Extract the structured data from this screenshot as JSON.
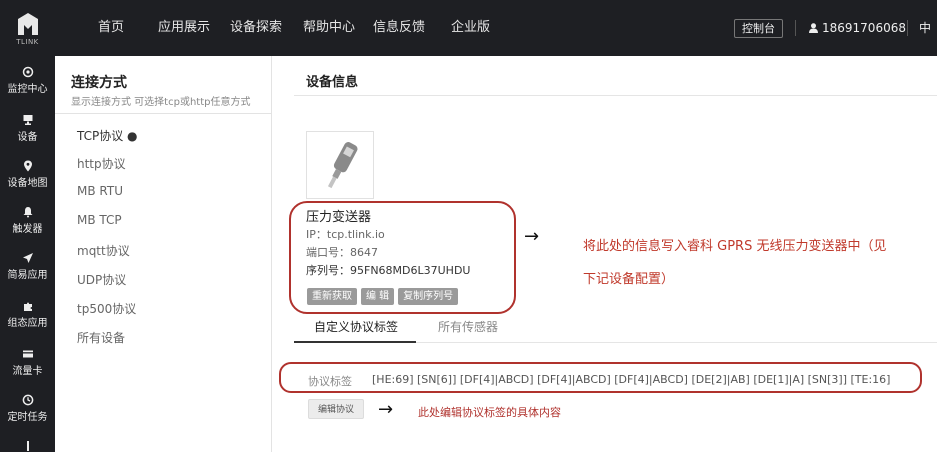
{
  "brand": {
    "logo_text": "TLINK",
    "logo_icon": "tlink-logo-icon"
  },
  "topnav": {
    "items": [
      "首页",
      "应用展示",
      "设备探索",
      "帮助中心",
      "信息反馈",
      "企业版"
    ],
    "console_button": "控制台",
    "user_phone": "18691706068",
    "user_icon": "user-icon",
    "lang_partial": "中"
  },
  "sidebar": {
    "items": [
      {
        "label": "监控中心",
        "icon": "target-icon"
      },
      {
        "label": "设备",
        "icon": "monitor-icon"
      },
      {
        "label": "设备地图",
        "icon": "map-pin-icon"
      },
      {
        "label": "触发器",
        "icon": "bell-icon"
      },
      {
        "label": "简易应用",
        "icon": "send-icon"
      },
      {
        "label": "组态应用",
        "icon": "puzzle-icon"
      },
      {
        "label": "流量卡",
        "icon": "card-icon"
      },
      {
        "label": "定时任务",
        "icon": "clock-icon"
      }
    ]
  },
  "protocol_panel": {
    "title": "连接方式",
    "subtitle": "显示连接方式 可选择tcp或http任意方式",
    "items": [
      "TCP协议 ●",
      "http协议",
      "MB RTU",
      "MB TCP",
      "mqtt协议",
      "UDP协议",
      "tp500协议",
      "所有设备"
    ]
  },
  "device": {
    "section_title": "设备信息",
    "image_icon": "pressure-sensor-icon",
    "name": "压力变送器",
    "ip": "IP：tcp.tlink.io",
    "port": "端口号：8647",
    "serial": "序列号：95FN68MD6L37UHDU",
    "buttons": {
      "refresh": "重新获取",
      "edit": "编 辑",
      "copy_serial": "复制序列号"
    }
  },
  "annotations": {
    "arrow": "→",
    "note_device_line1": "将此处的信息写入睿科 GPRS 无线压力变送器中（见",
    "note_device_line2": "下记设备配置）",
    "note_tags": "此处编辑协议标签的具体内容",
    "highlight_color": "#b0322d"
  },
  "tabs": {
    "custom_tags": "自定义协议标签",
    "all_sensors": "所有传感器"
  },
  "protocol_tags": {
    "label": "协议标签",
    "value": "[HE:69]  [SN[6]]  [DF[4]|ABCD]  [DF[4]|ABCD]  [DF[4]|ABCD]  [DE[2]|AB]  [DE[1]|A]  [SN[3]]  [TE:16]",
    "edit_button": "编辑协议"
  }
}
